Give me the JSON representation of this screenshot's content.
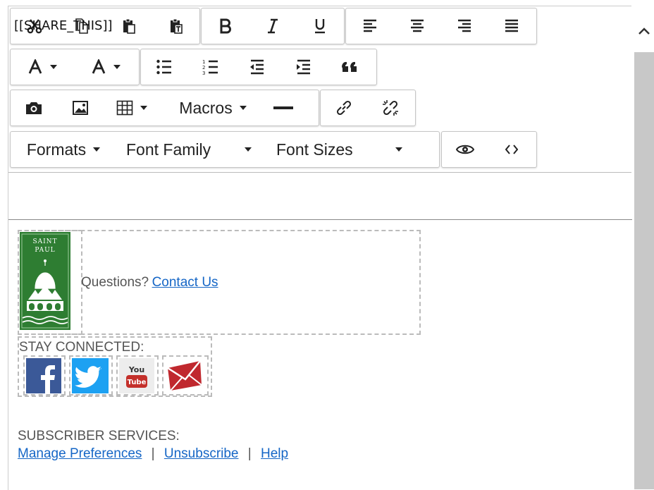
{
  "toolbar": {
    "macros_label": "Macros",
    "formats_label": "Formats",
    "font_family_label": "Font Family",
    "font_sizes_label": "Font Sizes"
  },
  "content": {
    "share_token": "[[SHARE_THIS]]",
    "logo_text": "SAINT PAUL",
    "questions_text": "Questions?",
    "contact_link": "Contact Us",
    "stay_connected": "STAY CONNECTED:",
    "subscriber_services": "SUBSCRIBER SERVICES:",
    "links": {
      "manage": "Manage Preferences",
      "unsubscribe": "Unsubscribe",
      "help": "Help",
      "sep": "|"
    }
  },
  "colors": {
    "link": "#1566c6",
    "facebook": "#3b5998",
    "twitter": "#1da1f2",
    "email_red": "#c0282e",
    "logo_green": "#2e7d32"
  },
  "icons": [
    "cut-icon",
    "copy-icon",
    "paste-icon",
    "paste-text-icon",
    "bold-icon",
    "italic-icon",
    "underline-icon",
    "align-left-icon",
    "align-center-icon",
    "align-right-icon",
    "align-justify-icon",
    "font-color-icon",
    "highlight-color-icon",
    "bullet-list-icon",
    "number-list-icon",
    "outdent-icon",
    "indent-icon",
    "blockquote-icon",
    "camera-icon",
    "image-icon",
    "table-icon",
    "horizontal-rule-icon",
    "link-icon",
    "unlink-icon",
    "preview-icon",
    "code-icon",
    "scroll-up-icon"
  ]
}
